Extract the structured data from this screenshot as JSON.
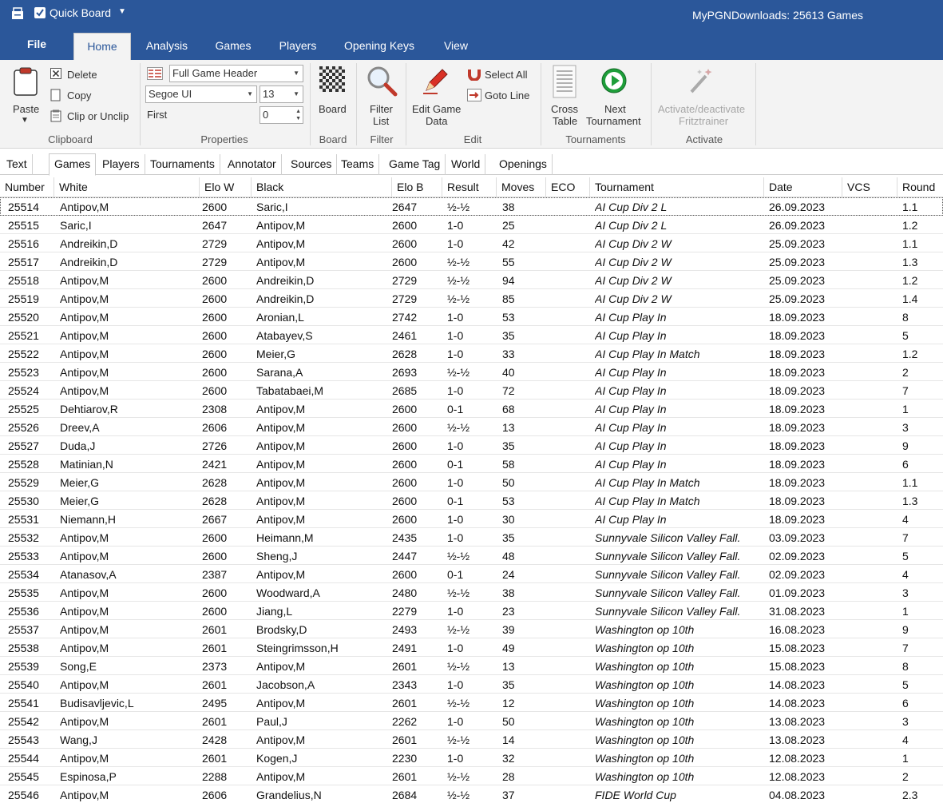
{
  "titlebar": {
    "quick_board_label": "Quick Board",
    "quick_board_checked": true,
    "app_title": "MyPGNDownloads:  25613 Games",
    "bg_color": "#2b579a"
  },
  "ribbon_tabs": {
    "file": "File",
    "home": "Home",
    "analysis": "Analysis",
    "games": "Games",
    "players": "Players",
    "opening_keys": "Opening Keys",
    "view": "View"
  },
  "clipboard": {
    "paste": "Paste",
    "delete": "Delete",
    "copy": "Copy",
    "clip": "Clip or Unclip",
    "group": "Clipboard"
  },
  "properties": {
    "header_combo": "Full Game Header",
    "font_combo": "Segoe UI",
    "size_combo": "13",
    "first_label": "First",
    "first_value": "0",
    "group": "Properties"
  },
  "board": {
    "label": "Board",
    "group": "Board"
  },
  "filter": {
    "label1": "Filter",
    "label2": "List",
    "group": "Filter"
  },
  "edit": {
    "edit_game1": "Edit Game",
    "edit_game2": "Data",
    "select_all": "Select All",
    "goto_line": "Goto Line",
    "group": "Edit"
  },
  "tournaments": {
    "cross1": "Cross",
    "cross2": "Table",
    "next1": "Next",
    "next2": "Tournament",
    "group": "Tournaments"
  },
  "activate": {
    "label1": "Activate/deactivate",
    "label2": "Fritztrainer",
    "group": "Activate"
  },
  "subtabs": [
    "Text",
    "Games",
    "Players",
    "Tournaments",
    "Annotator",
    "Sources",
    "Teams",
    "Game Tag",
    "World",
    "Openings"
  ],
  "columns": [
    "Number",
    "White",
    "Elo W",
    "Black",
    "Elo B",
    "Result",
    "Moves",
    "ECO",
    "Tournament",
    "Date",
    "VCS",
    "Round"
  ],
  "rows": [
    [
      "25514",
      "Antipov,M",
      "2600",
      "Saric,I",
      "2647",
      "½-½",
      "38",
      "",
      "AI Cup Div 2 L",
      "26.09.2023",
      "",
      "1.1"
    ],
    [
      "25515",
      "Saric,I",
      "2647",
      "Antipov,M",
      "2600",
      "1-0",
      "25",
      "",
      "AI Cup Div 2 L",
      "26.09.2023",
      "",
      "1.2"
    ],
    [
      "25516",
      "Andreikin,D",
      "2729",
      "Antipov,M",
      "2600",
      "1-0",
      "42",
      "",
      "AI Cup Div 2 W",
      "25.09.2023",
      "",
      "1.1"
    ],
    [
      "25517",
      "Andreikin,D",
      "2729",
      "Antipov,M",
      "2600",
      "½-½",
      "55",
      "",
      "AI Cup Div 2 W",
      "25.09.2023",
      "",
      "1.3"
    ],
    [
      "25518",
      "Antipov,M",
      "2600",
      "Andreikin,D",
      "2729",
      "½-½",
      "94",
      "",
      "AI Cup Div 2 W",
      "25.09.2023",
      "",
      "1.2"
    ],
    [
      "25519",
      "Antipov,M",
      "2600",
      "Andreikin,D",
      "2729",
      "½-½",
      "85",
      "",
      "AI Cup Div 2 W",
      "25.09.2023",
      "",
      "1.4"
    ],
    [
      "25520",
      "Antipov,M",
      "2600",
      "Aronian,L",
      "2742",
      "1-0",
      "53",
      "",
      "AI Cup Play In",
      "18.09.2023",
      "",
      "8"
    ],
    [
      "25521",
      "Antipov,M",
      "2600",
      "Atabayev,S",
      "2461",
      "1-0",
      "35",
      "",
      "AI Cup Play In",
      "18.09.2023",
      "",
      "5"
    ],
    [
      "25522",
      "Antipov,M",
      "2600",
      "Meier,G",
      "2628",
      "1-0",
      "33",
      "",
      "AI Cup Play In Match",
      "18.09.2023",
      "",
      "1.2"
    ],
    [
      "25523",
      "Antipov,M",
      "2600",
      "Sarana,A",
      "2693",
      "½-½",
      "40",
      "",
      "AI Cup Play In",
      "18.09.2023",
      "",
      "2"
    ],
    [
      "25524",
      "Antipov,M",
      "2600",
      "Tabatabaei,M",
      "2685",
      "1-0",
      "72",
      "",
      "AI Cup Play In",
      "18.09.2023",
      "",
      "7"
    ],
    [
      "25525",
      "Dehtiarov,R",
      "2308",
      "Antipov,M",
      "2600",
      "0-1",
      "68",
      "",
      "AI Cup Play In",
      "18.09.2023",
      "",
      "1"
    ],
    [
      "25526",
      "Dreev,A",
      "2606",
      "Antipov,M",
      "2600",
      "½-½",
      "13",
      "",
      "AI Cup Play In",
      "18.09.2023",
      "",
      "3"
    ],
    [
      "25527",
      "Duda,J",
      "2726",
      "Antipov,M",
      "2600",
      "1-0",
      "35",
      "",
      "AI Cup Play In",
      "18.09.2023",
      "",
      "9"
    ],
    [
      "25528",
      "Matinian,N",
      "2421",
      "Antipov,M",
      "2600",
      "0-1",
      "58",
      "",
      "AI Cup Play In",
      "18.09.2023",
      "",
      "6"
    ],
    [
      "25529",
      "Meier,G",
      "2628",
      "Antipov,M",
      "2600",
      "1-0",
      "50",
      "",
      "AI Cup Play In Match",
      "18.09.2023",
      "",
      "1.1"
    ],
    [
      "25530",
      "Meier,G",
      "2628",
      "Antipov,M",
      "2600",
      "0-1",
      "53",
      "",
      "AI Cup Play In Match",
      "18.09.2023",
      "",
      "1.3"
    ],
    [
      "25531",
      "Niemann,H",
      "2667",
      "Antipov,M",
      "2600",
      "1-0",
      "30",
      "",
      "AI Cup Play In",
      "18.09.2023",
      "",
      "4"
    ],
    [
      "25532",
      "Antipov,M",
      "2600",
      "Heimann,M",
      "2435",
      "1-0",
      "35",
      "",
      "Sunnyvale Silicon Valley Fall.",
      "03.09.2023",
      "",
      "7"
    ],
    [
      "25533",
      "Antipov,M",
      "2600",
      "Sheng,J",
      "2447",
      "½-½",
      "48",
      "",
      "Sunnyvale Silicon Valley Fall.",
      "02.09.2023",
      "",
      "5"
    ],
    [
      "25534",
      "Atanasov,A",
      "2387",
      "Antipov,M",
      "2600",
      "0-1",
      "24",
      "",
      "Sunnyvale Silicon Valley Fall.",
      "02.09.2023",
      "",
      "4"
    ],
    [
      "25535",
      "Antipov,M",
      "2600",
      "Woodward,A",
      "2480",
      "½-½",
      "38",
      "",
      "Sunnyvale Silicon Valley Fall.",
      "01.09.2023",
      "",
      "3"
    ],
    [
      "25536",
      "Antipov,M",
      "2600",
      "Jiang,L",
      "2279",
      "1-0",
      "23",
      "",
      "Sunnyvale Silicon Valley Fall.",
      "31.08.2023",
      "",
      "1"
    ],
    [
      "25537",
      "Antipov,M",
      "2601",
      "Brodsky,D",
      "2493",
      "½-½",
      "39",
      "",
      "Washington op 10th",
      "16.08.2023",
      "",
      "9"
    ],
    [
      "25538",
      "Antipov,M",
      "2601",
      "Steingrimsson,H",
      "2491",
      "1-0",
      "49",
      "",
      "Washington op 10th",
      "15.08.2023",
      "",
      "7"
    ],
    [
      "25539",
      "Song,E",
      "2373",
      "Antipov,M",
      "2601",
      "½-½",
      "13",
      "",
      "Washington op 10th",
      "15.08.2023",
      "",
      "8"
    ],
    [
      "25540",
      "Antipov,M",
      "2601",
      "Jacobson,A",
      "2343",
      "1-0",
      "35",
      "",
      "Washington op 10th",
      "14.08.2023",
      "",
      "5"
    ],
    [
      "25541",
      "Budisavljevic,L",
      "2495",
      "Antipov,M",
      "2601",
      "½-½",
      "12",
      "",
      "Washington op 10th",
      "14.08.2023",
      "",
      "6"
    ],
    [
      "25542",
      "Antipov,M",
      "2601",
      "Paul,J",
      "2262",
      "1-0",
      "50",
      "",
      "Washington op 10th",
      "13.08.2023",
      "",
      "3"
    ],
    [
      "25543",
      "Wang,J",
      "2428",
      "Antipov,M",
      "2601",
      "½-½",
      "14",
      "",
      "Washington op 10th",
      "13.08.2023",
      "",
      "4"
    ],
    [
      "25544",
      "Antipov,M",
      "2601",
      "Kogen,J",
      "2230",
      "1-0",
      "32",
      "",
      "Washington op 10th",
      "12.08.2023",
      "",
      "1"
    ],
    [
      "25545",
      "Espinosa,P",
      "2288",
      "Antipov,M",
      "2601",
      "½-½",
      "28",
      "",
      "Washington op 10th",
      "12.08.2023",
      "",
      "2"
    ],
    [
      "25546",
      "Antipov,M",
      "2606",
      "Grandelius,N",
      "2684",
      "½-½",
      "37",
      "",
      "FIDE World Cup",
      "04.08.2023",
      "",
      "2.3"
    ]
  ]
}
